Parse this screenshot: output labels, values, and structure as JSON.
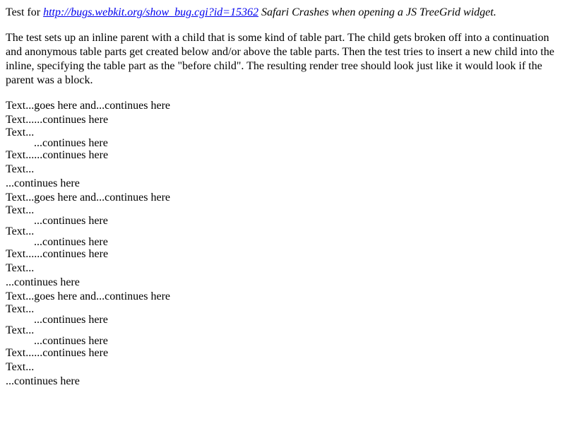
{
  "intro": {
    "prefix": "Test for ",
    "link_text": "http://bugs.webkit.org/show_bug.cgi?id=15362",
    "title": " Safari Crashes when opening a JS TreeGrid widget."
  },
  "description": "The test sets up an inline parent with a child that is some kind of table part. The child gets broken off into a continuation and anonymous table parts get created below and/or above the table parts. Then the test tries to insert a new child into the inline, specifying the table part as the \"before child\". The resulting render tree should look just like it would look if the parent was a block.",
  "lines": {
    "g1": {
      "a": "Text...goes here and...continues here",
      "b": "Text......continues here",
      "c1": "Text...",
      "c2": "...continues here",
      "d": "Text......continues here",
      "e": "Text...",
      "f": "...continues here"
    },
    "g2": {
      "a": "Text...goes here and...continues here",
      "b1": "Text...",
      "b2": "...continues here",
      "c1": "Text...",
      "c2": "...continues here",
      "d": "Text......continues here",
      "e": "Text...",
      "f": "...continues here"
    },
    "g3": {
      "a": "Text...goes here and...continues here",
      "b1": "Text...",
      "b2": "...continues here",
      "c1": "Text...",
      "c2": "...continues here",
      "d": "Text......continues here",
      "e": "Text...",
      "f": "...continues here"
    }
  }
}
